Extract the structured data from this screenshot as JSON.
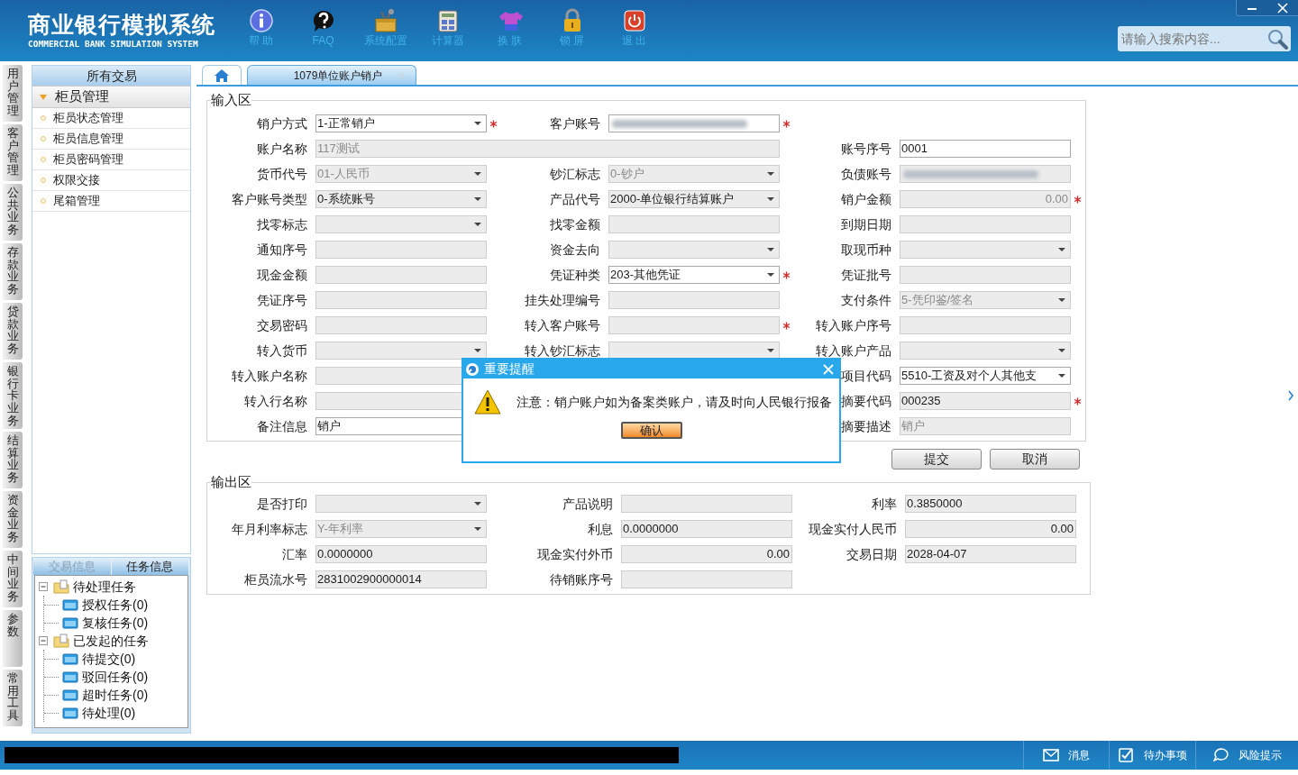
{
  "header": {
    "title": "商业银行模拟系统",
    "subtitle": "COMMERCIAL BANK SIMULATION SYSTEM",
    "tools": [
      {
        "kind": "help",
        "label": "帮 助"
      },
      {
        "kind": "faq",
        "label": "FAQ"
      },
      {
        "kind": "config",
        "label": "系统配置"
      },
      {
        "kind": "calculator",
        "label": "计算器"
      },
      {
        "kind": "skin",
        "label": "换 肤"
      },
      {
        "kind": "lock",
        "label": "锁 屏"
      },
      {
        "kind": "exit",
        "label": "退 出"
      }
    ],
    "search": {
      "placeholder": "请输入搜索内容..."
    }
  },
  "module_tabs": [
    "用户管理",
    "客户管理",
    "公共业务",
    "存款业务",
    "贷款业务",
    "银行卡业务",
    "结算业务",
    "资金业务",
    "中间业务",
    "参数",
    "常用工具"
  ],
  "sidebar": {
    "title": "所有交易",
    "groups": [
      {
        "label": "柜员管理",
        "expanded": true,
        "items": [
          "柜员状态管理",
          "柜员信息管理",
          "柜员密码管理",
          "权限交接",
          "尾箱管理"
        ]
      }
    ],
    "bottom_tabs": [
      {
        "label": "交易信息",
        "selected": false
      },
      {
        "label": "任务信息",
        "selected": true
      }
    ],
    "task_tree": [
      {
        "label": "待处理任务",
        "expanded": true,
        "children": [
          {
            "label": "授权任务(0)"
          },
          {
            "label": "复核任务(0)"
          }
        ]
      },
      {
        "label": "已发起的任务",
        "expanded": true,
        "children": [
          {
            "label": "待提交(0)"
          },
          {
            "label": "驳回任务(0)"
          },
          {
            "label": "超时任务(0)"
          },
          {
            "label": "待处理(0)"
          }
        ]
      }
    ]
  },
  "tabs": [
    {
      "kind": "home",
      "selected": false
    },
    {
      "kind": "page",
      "label": "1079单位账户销户",
      "selected": true
    }
  ],
  "input_area": {
    "title": "输入区",
    "rows": [
      [
        {
          "label": "销户方式",
          "kind": "select",
          "value": "1-正常销户",
          "editable": true,
          "dimmed": false,
          "required": true
        },
        {
          "label": "客户账号",
          "kind": "masked",
          "editable": true,
          "required": true
        },
        ""
      ],
      [
        {
          "label": "账户名称",
          "kind": "wide",
          "value": "117测试",
          "editable": false,
          "dimmed": true,
          "required": false
        },
        "",
        {
          "label": "账号序号",
          "kind": "text",
          "value": "0001",
          "editable": true,
          "dimmed": false,
          "required": false
        }
      ],
      [
        {
          "label": "货币代号",
          "kind": "select",
          "value": "01-人民币",
          "editable": false,
          "dimmed": true,
          "required": false
        },
        {
          "label": "钞汇标志",
          "kind": "select",
          "value": "0-钞户",
          "editable": false,
          "dimmed": true,
          "required": false
        },
        {
          "label": "负债账号",
          "kind": "masked",
          "editable": false,
          "required": false
        }
      ],
      [
        {
          "label": "客户账号类型",
          "kind": "select",
          "value": "0-系统账号",
          "editable": false,
          "dimmed": false,
          "required": false
        },
        {
          "label": "产品代号",
          "kind": "select",
          "value": "2000-单位银行结算账户",
          "editable": false,
          "dimmed": false,
          "required": false
        },
        {
          "label": "销户金额",
          "kind": "amount",
          "value": "0.00",
          "editable": false,
          "dimmed": true,
          "required": true
        }
      ],
      [
        {
          "label": "找零标志",
          "kind": "select",
          "editable": false,
          "required": false
        },
        {
          "label": "找零金额",
          "kind": "text",
          "editable": false,
          "required": false
        },
        {
          "label": "到期日期",
          "kind": "text",
          "editable": false,
          "required": false
        }
      ],
      [
        {
          "label": "通知序号",
          "kind": "text",
          "editable": false,
          "required": false
        },
        {
          "label": "资金去向",
          "kind": "select",
          "editable": false,
          "required": false
        },
        {
          "label": "取现币种",
          "kind": "select",
          "editable": false,
          "required": false
        }
      ],
      [
        {
          "label": "现金金额",
          "kind": "text",
          "editable": false,
          "required": false
        },
        {
          "label": "凭证种类",
          "kind": "select",
          "value": "203-其他凭证",
          "editable": true,
          "dimmed": false,
          "required": true
        },
        {
          "label": "凭证批号",
          "kind": "text",
          "editable": false,
          "required": false
        }
      ],
      [
        {
          "label": "凭证序号",
          "kind": "text",
          "editable": false,
          "required": false
        },
        {
          "label": "挂失处理编号",
          "kind": "text",
          "editable": false,
          "required": false
        },
        {
          "label": "支付条件",
          "kind": "select",
          "value": "5-凭印鉴/签名",
          "editable": false,
          "dimmed": true,
          "required": false
        }
      ],
      [
        {
          "label": "交易密码",
          "kind": "text",
          "editable": false,
          "required": false
        },
        {
          "label": "转入客户账号",
          "kind": "text",
          "editable": false,
          "required": true
        },
        {
          "label": "转入账户序号",
          "kind": "text",
          "editable": false,
          "required": false
        }
      ],
      [
        {
          "label": "转入货币",
          "kind": "select",
          "editable": false,
          "required": false
        },
        {
          "label": "转入钞汇标志",
          "kind": "select",
          "editable": false,
          "required": false
        },
        {
          "label": "转入账户产品",
          "kind": "select",
          "editable": false,
          "required": false
        }
      ],
      [
        {
          "label": "转入账户名称",
          "kind": "text",
          "editable": false,
          "required": false
        },
        "",
        {
          "label": "项目代码",
          "kind": "select",
          "value": "5510-工资及对个人其他支",
          "editable": true,
          "dimmed": false,
          "required": false
        }
      ],
      [
        {
          "label": "转入行名称",
          "kind": "text",
          "editable": false,
          "required": false
        },
        "",
        {
          "label": "摘要代码",
          "kind": "text",
          "value": "000235",
          "editable": false,
          "dimmed": false,
          "required": true
        }
      ],
      [
        {
          "label": "备注信息",
          "kind": "text",
          "value": "销户",
          "editable": true,
          "dimmed": false,
          "required": false
        },
        "",
        {
          "label": "摘要描述",
          "kind": "text",
          "value": "销户",
          "editable": false,
          "dimmed": true,
          "required": false
        }
      ]
    ]
  },
  "buttons": [
    "提交",
    "取消"
  ],
  "output_area": {
    "title": "输出区",
    "rows": [
      [
        {
          "label": "是否打印",
          "kind": "select",
          "editable": false,
          "required": false
        },
        {
          "label": "产品说明",
          "kind": "text",
          "editable": false,
          "required": false
        },
        {
          "label": "利率",
          "kind": "text",
          "value": "0.3850000",
          "editable": false,
          "dimmed": false,
          "required": false
        }
      ],
      [
        {
          "label": "年月利率标志",
          "kind": "select",
          "value": "Y-年利率",
          "editable": false,
          "dimmed": true,
          "required": false
        },
        {
          "label": "利息",
          "kind": "text",
          "value": "0.0000000",
          "editable": false,
          "dimmed": false,
          "required": false
        },
        {
          "label": "现金实付人民币",
          "kind": "amount",
          "value": "0.00",
          "editable": false,
          "dimmed": false,
          "required": false
        }
      ],
      [
        {
          "label": "汇率",
          "kind": "text",
          "value": "0.0000000",
          "editable": false,
          "dimmed": false,
          "required": false
        },
        {
          "label": "现金实付外币",
          "kind": "amount",
          "value": "0.00",
          "editable": false,
          "dimmed": false,
          "required": false
        },
        {
          "label": "交易日期",
          "kind": "text",
          "value": "2028-04-07",
          "editable": false,
          "dimmed": false,
          "required": false
        }
      ],
      [
        {
          "label": "柜员流水号",
          "kind": "text",
          "value": "2831002900000014",
          "editable": false,
          "dimmed": false,
          "required": false
        },
        {
          "label": "待销账序号",
          "kind": "text",
          "editable": false,
          "required": false
        },
        ""
      ]
    ]
  },
  "dialog": {
    "title": "重要提醒",
    "message": "注意：销户账户如为备案类账户，请及时向人民银行报备",
    "button": "确认"
  },
  "status_bar": {
    "items": [
      {
        "kind": "message",
        "label": "消息"
      },
      {
        "kind": "todo",
        "label": "待办事项"
      },
      {
        "kind": "risk",
        "label": "风险提示"
      }
    ]
  }
}
